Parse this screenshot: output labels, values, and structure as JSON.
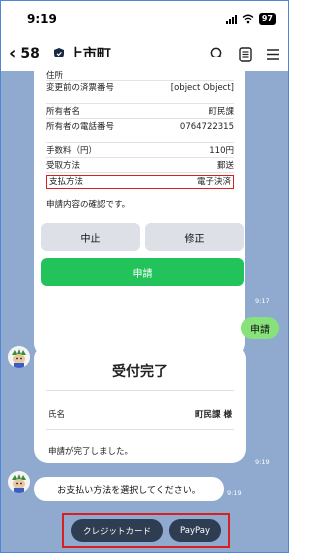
{
  "status_bar": {
    "time": "9:19",
    "battery": "97"
  },
  "header": {
    "back_count": "58",
    "title": "上市町"
  },
  "form": {
    "rows": [
      {
        "label": "住所",
        "value": ""
      },
      {
        "label": "変更前の済票番号",
        "value": "[object Object]"
      },
      {
        "label": "所有者名",
        "value": "町民課"
      },
      {
        "label": "所有者の電話番号",
        "value": "0764722315"
      },
      {
        "label": "手数料（円）",
        "value": "110円"
      },
      {
        "label": "受取方法",
        "value": "郵送"
      },
      {
        "label": "支払方法",
        "value": "電子決済"
      }
    ],
    "confirm_text": "申請内容の確認です。",
    "cancel_label": "中止",
    "edit_label": "修正",
    "apply_label": "申請",
    "time": "9:17"
  },
  "user_message": {
    "text": "申請",
    "read": "既読",
    "time": "9:18"
  },
  "receipt": {
    "title": "受付完了",
    "name_label": "氏名",
    "name_value": "町民課 様",
    "done_text": "申請が完了しました。",
    "time": "9:19"
  },
  "prompt_message": {
    "text": "お支払い方法を選択してください。",
    "time": "9:19"
  },
  "quick_replies": [
    {
      "label": "クレジットカード"
    },
    {
      "label": "PayPay"
    }
  ],
  "colors": {
    "chat_bg": "#8fa9cf",
    "green": "#21c35a",
    "user_bubble": "#87e27a",
    "quick_reply": "#2f3d52",
    "highlight": "#d72020"
  }
}
